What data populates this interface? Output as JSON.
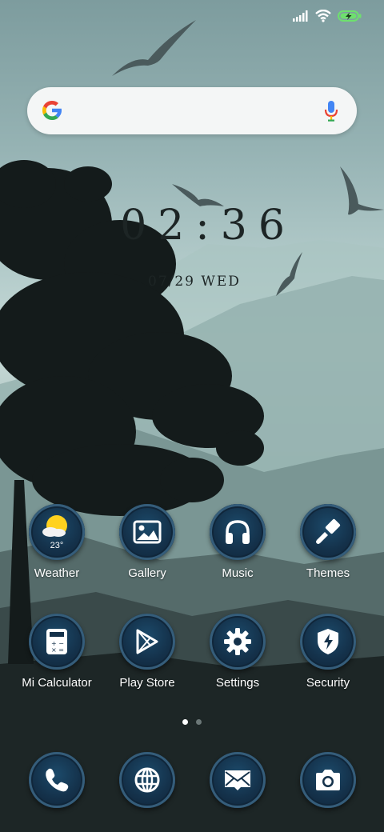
{
  "home": {
    "clock": "02:36",
    "date": "07/29 WED",
    "weather_temp": "23°",
    "apps": [
      {
        "label": "Weather"
      },
      {
        "label": "Gallery"
      },
      {
        "label": "Music"
      },
      {
        "label": "Themes"
      },
      {
        "label": "Mi Calculator"
      },
      {
        "label": "Play Store"
      },
      {
        "label": "Settings"
      },
      {
        "label": "Security"
      }
    ],
    "dock": [
      {
        "icon": "phone-icon"
      },
      {
        "icon": "globe-icon"
      },
      {
        "icon": "mail-icon"
      },
      {
        "icon": "camera-icon"
      }
    ],
    "page_indicator": {
      "pages": 2,
      "current": 1
    }
  },
  "status_bar": {
    "battery": "charging",
    "signal": "full",
    "wifi": "connected"
  },
  "colors": {
    "accent": "#14314a",
    "ring": "#355d7a",
    "label": "#ffffff"
  }
}
